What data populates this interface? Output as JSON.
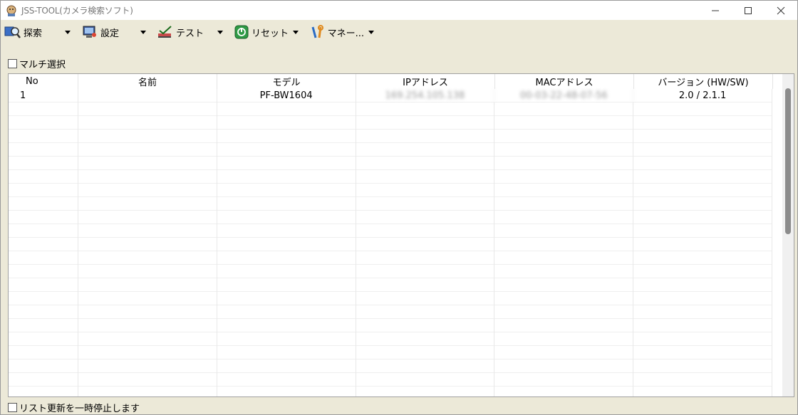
{
  "window": {
    "title": "JSS-TOOL(カメラ検索ソフト)",
    "minimize": "—",
    "maximize": "☐",
    "close": "✕"
  },
  "toolbar": {
    "search_label": "探索",
    "settings_label": "設定",
    "test_label": "テスト",
    "reset_label": "リセット",
    "manage_label": "マネー..."
  },
  "multi_select_label": "マルチ選択",
  "pause_label": "リスト更新を一時停止します",
  "table": {
    "columns": [
      "No",
      "名前",
      "モデル",
      "IPアドレス",
      "MACアドレス",
      "バージョン (HW/SW)"
    ],
    "rows": [
      {
        "no": "1",
        "name": "",
        "model": "PF-BW1604",
        "ip": "169.254.105.138",
        "mac": "00-03-22-48-07-56",
        "version": "2.0 / 2.1.1"
      }
    ]
  },
  "colors": {
    "window_bg": "#ece9d8",
    "grid_bg": "#ffffff",
    "scroll_thumb": "#8c8c8c"
  }
}
